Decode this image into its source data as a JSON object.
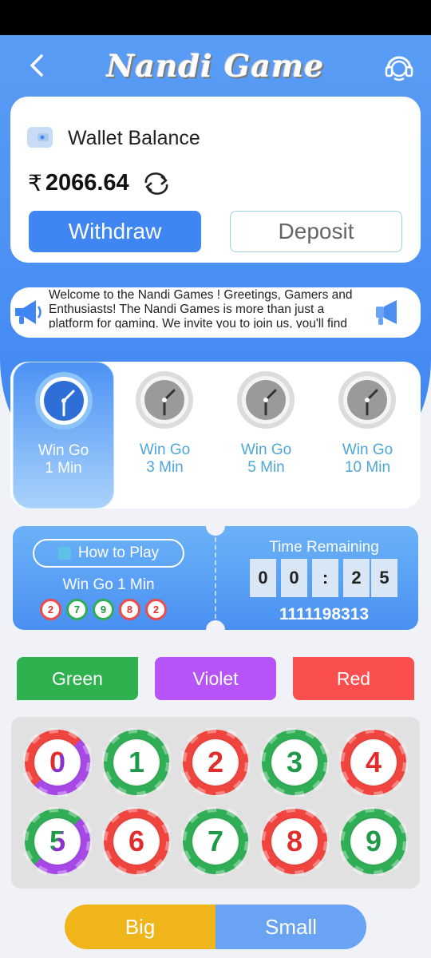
{
  "header": {
    "title": "Nandi Game"
  },
  "wallet": {
    "label": "Wallet Balance",
    "currency": "₹",
    "balance": "2066.64",
    "withdraw_label": "Withdraw",
    "deposit_label": "Deposit"
  },
  "notice": {
    "text": "Welcome to the Nandi Games ! Greetings, Gamers and Enthusiasts! The Nandi Games is more than just a platform for gaming. We invite you to join us, you'll find"
  },
  "tabs": [
    {
      "line1": "Win Go",
      "line2": "1 Min",
      "active": true
    },
    {
      "line1": "Win Go",
      "line2": "3 Min",
      "active": false
    },
    {
      "line1": "Win Go",
      "line2": "5 Min",
      "active": false
    },
    {
      "line1": "Win Go",
      "line2": "10 Min",
      "active": false
    }
  ],
  "timer": {
    "how_to_play_label": "How to Play",
    "game_mode": "Win Go 1 Min",
    "recent_results": [
      "2",
      "7",
      "9",
      "8",
      "2"
    ],
    "time_remaining_label": "Time Remaining",
    "digits": [
      "0",
      "0",
      ":",
      "2",
      "5"
    ],
    "period_id": "1111198313"
  },
  "color_buttons": {
    "green": "Green",
    "violet": "Violet",
    "red": "Red"
  },
  "numbers": [
    "0",
    "1",
    "2",
    "3",
    "4",
    "5",
    "6",
    "7",
    "8",
    "9"
  ],
  "size_buttons": {
    "big": "Big",
    "small": "Small"
  },
  "colors": {
    "primary_blue": "#3f86f2",
    "green": "#2fb14f",
    "violet": "#b654f7",
    "red": "#fb4e4e",
    "yellow": "#f0b51b"
  }
}
